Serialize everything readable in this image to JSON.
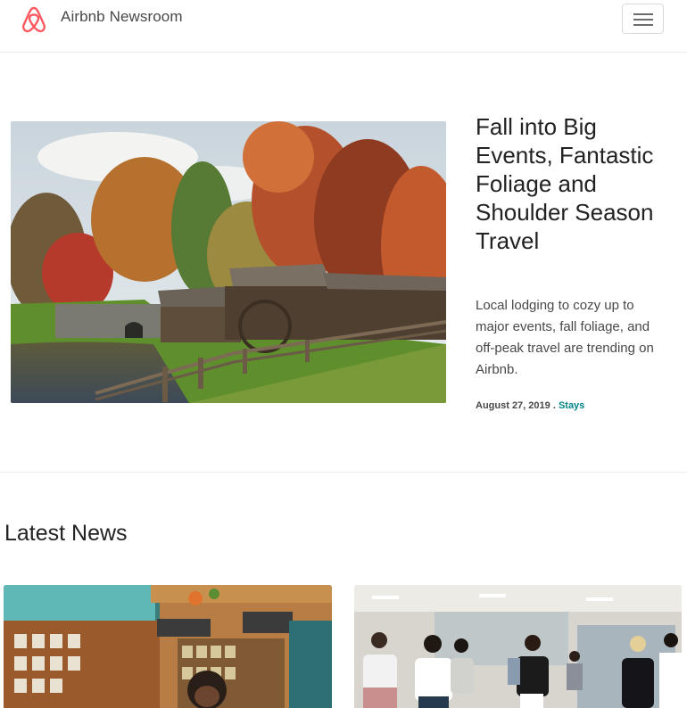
{
  "navbar": {
    "brand_title": "Airbnb Newsroom",
    "logo_icon": "airbnb-belo-icon",
    "menu_icon": "hamburger-menu-icon",
    "brand_color": "#ff5a5f"
  },
  "featured": {
    "title": "Fall into Big Events, Fantastic Foliage and Shoulder Season Travel",
    "description": "Local lodging to cozy up to major events, fall foliage, and off-peak travel are trending on Airbnb.",
    "date": "August 27, 2019 .",
    "category": "Stays",
    "category_color": "#008489"
  },
  "latest": {
    "heading": "Latest News"
  }
}
